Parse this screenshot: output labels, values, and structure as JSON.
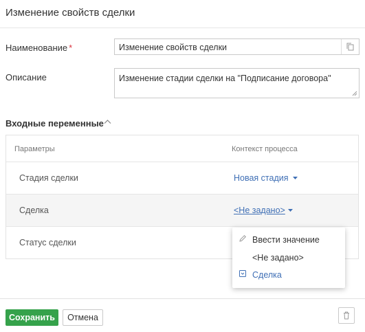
{
  "dialog": {
    "title": "Изменение свойств сделки"
  },
  "form": {
    "name_label": "Наименование",
    "required_mark": "*",
    "name_value": "Изменение свойств сделки",
    "description_label": "Описание",
    "description_value": "Изменение стадии сделки на \"Подписание договора\""
  },
  "inputs": {
    "section_title": "Входные переменные",
    "columns": [
      "Параметры",
      "Контекст процесса"
    ],
    "rows": [
      {
        "name": "Стадия сделки",
        "context": "Новая стадия"
      },
      {
        "name": "Сделка",
        "context": "<Не задано>"
      },
      {
        "name": "Статус сделки",
        "context": ""
      }
    ]
  },
  "dropdown": {
    "items": [
      {
        "label": "Ввести значение",
        "icon": "pencil-icon"
      },
      {
        "label": "<Не задано>",
        "icon": ""
      },
      {
        "label": "Сделка",
        "icon": "object-icon"
      }
    ]
  },
  "footer": {
    "save_label": "Сохранить",
    "cancel_label": "Отмена"
  },
  "colors": {
    "primary": "#35a24b",
    "link": "#3f6fb5",
    "required": "#d9343f"
  }
}
